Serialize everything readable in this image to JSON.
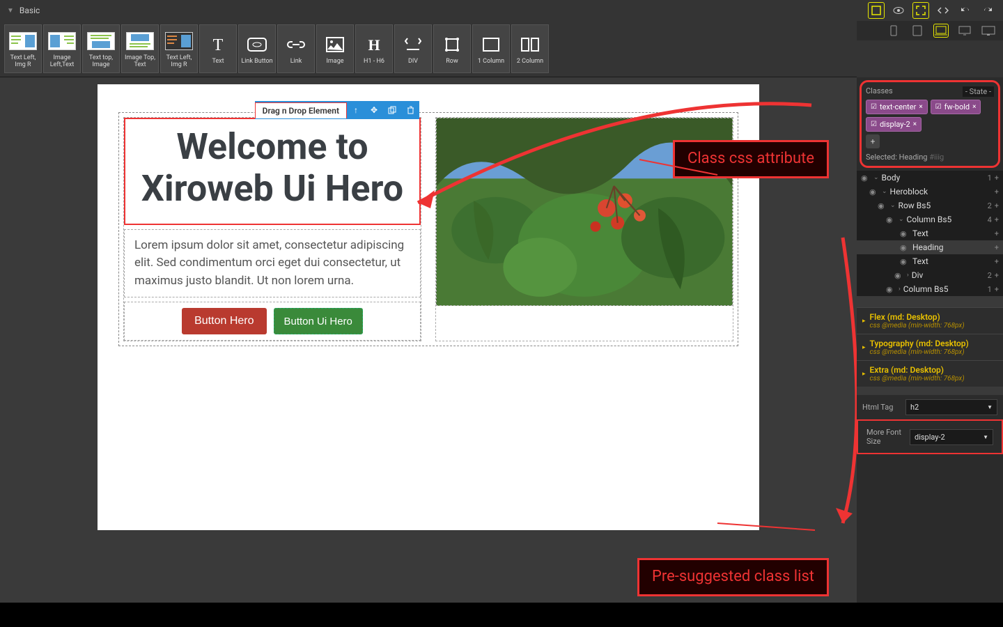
{
  "header": {
    "section_label": "Basic"
  },
  "top_icons": [
    "square-icon",
    "eye-icon",
    "fullscreen-icon",
    "code-icon",
    "undo-icon",
    "redo-icon"
  ],
  "devices": [
    "phone",
    "tablet",
    "laptop",
    "desktop",
    "wide"
  ],
  "components": [
    {
      "label": "Text Left, Img R"
    },
    {
      "label": "Image Left,Text"
    },
    {
      "label": "Text top, Image"
    },
    {
      "label": "Image Top, Text"
    },
    {
      "label": "Text Left, Img R"
    },
    {
      "label": "Text"
    },
    {
      "label": "Link Button"
    },
    {
      "label": "Link"
    },
    {
      "label": "Image"
    },
    {
      "label": "H1 - H6"
    },
    {
      "label": "DIV"
    },
    {
      "label": "Row"
    },
    {
      "label": "1 Column"
    },
    {
      "label": "2 Column"
    }
  ],
  "canvas": {
    "drag_label": "Drag n Drop Element",
    "heading": "Welcome to Xiroweb Ui Hero",
    "paragraph": "Lorem ipsum dolor sit amet, consectetur adipiscing elit. Sed condimentum orci eget dui consectetur, ut maximus justo blandit. Ut non lorem urna.",
    "button1": "Button Hero",
    "button2": "Button Ui Hero"
  },
  "classes_panel": {
    "title": "Classes",
    "state": "- State -",
    "chips": [
      "text-center",
      "fw-bold",
      "display-2"
    ],
    "selected_label": "Selected:",
    "selected_value": "Heading",
    "selected_id": "#iiig"
  },
  "tree": [
    {
      "label": "Body",
      "indent": 0,
      "open": true,
      "count": "1",
      "plus": true
    },
    {
      "label": "Heroblock",
      "indent": 1,
      "open": true,
      "count": "",
      "plus": true
    },
    {
      "label": "Row Bs5",
      "indent": 2,
      "open": true,
      "count": "2",
      "plus": true
    },
    {
      "label": "Column Bs5",
      "indent": 3,
      "open": true,
      "count": "4",
      "plus": true
    },
    {
      "label": "Text",
      "indent": 4,
      "open": false,
      "count": "",
      "plus": true
    },
    {
      "label": "Heading",
      "indent": 4,
      "open": false,
      "count": "",
      "plus": true,
      "highlighted": true
    },
    {
      "label": "Text",
      "indent": 4,
      "open": false,
      "count": "",
      "plus": true
    },
    {
      "label": "Div",
      "indent": 4,
      "open": true,
      "count": "2",
      "plus": true,
      "chev": true
    },
    {
      "label": "Column Bs5",
      "indent": 3,
      "open": true,
      "count": "1",
      "plus": true,
      "chev": true
    }
  ],
  "style_sections": [
    {
      "title": "Flex (md: Desktop)",
      "sub": "css @media (min-width: 768px)"
    },
    {
      "title": "Typography (md: Desktop)",
      "sub": "css @media (min-width: 768px)"
    },
    {
      "title": "Extra (md: Desktop)",
      "sub": "css @media (min-width: 768px)"
    }
  ],
  "props": {
    "html_tag_label": "Html Tag",
    "html_tag_value": "h2",
    "font_label": "More Font Size",
    "font_value": "display-2"
  },
  "annotations": {
    "class_css": "Class css attribute",
    "suggested": "Pre-suggested class list"
  }
}
